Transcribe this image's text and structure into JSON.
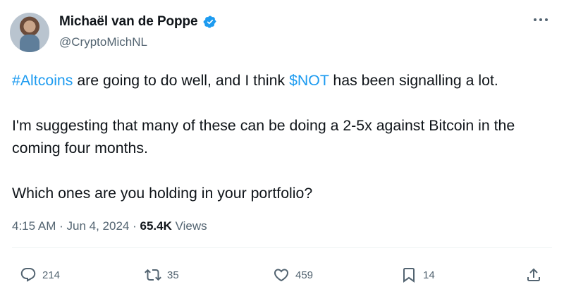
{
  "author": {
    "name": "Michaël van de Poppe",
    "handle": "@CryptoMichNL",
    "verified": true,
    "verified_color": "#1d9bf0"
  },
  "tweet": {
    "paragraphs": [
      [
        {
          "text": "#Altcoins",
          "link": true
        },
        {
          "text": " are going to do well, and I think ",
          "link": false
        },
        {
          "text": "$NOT",
          "link": true
        },
        {
          "text": " has been signalling a lot.",
          "link": false
        }
      ],
      [
        {
          "text": "I'm suggesting that many of these can be doing a 2-5x against Bitcoin in the coming four months.",
          "link": false
        }
      ],
      [
        {
          "text": "Which ones are you holding in your portfolio?",
          "link": false
        }
      ]
    ],
    "link_color": "#1d9bf0"
  },
  "meta": {
    "time": "4:15 AM",
    "separator": "·",
    "date": "Jun 4, 2024",
    "views_count": "65.4K",
    "views_label": "Views"
  },
  "actions": {
    "replies": "214",
    "retweets": "35",
    "likes": "459",
    "bookmarks": "14"
  },
  "icons": [
    "verified-badge-icon",
    "more-icon",
    "reply-icon",
    "retweet-icon",
    "like-icon",
    "bookmark-icon",
    "share-icon"
  ]
}
